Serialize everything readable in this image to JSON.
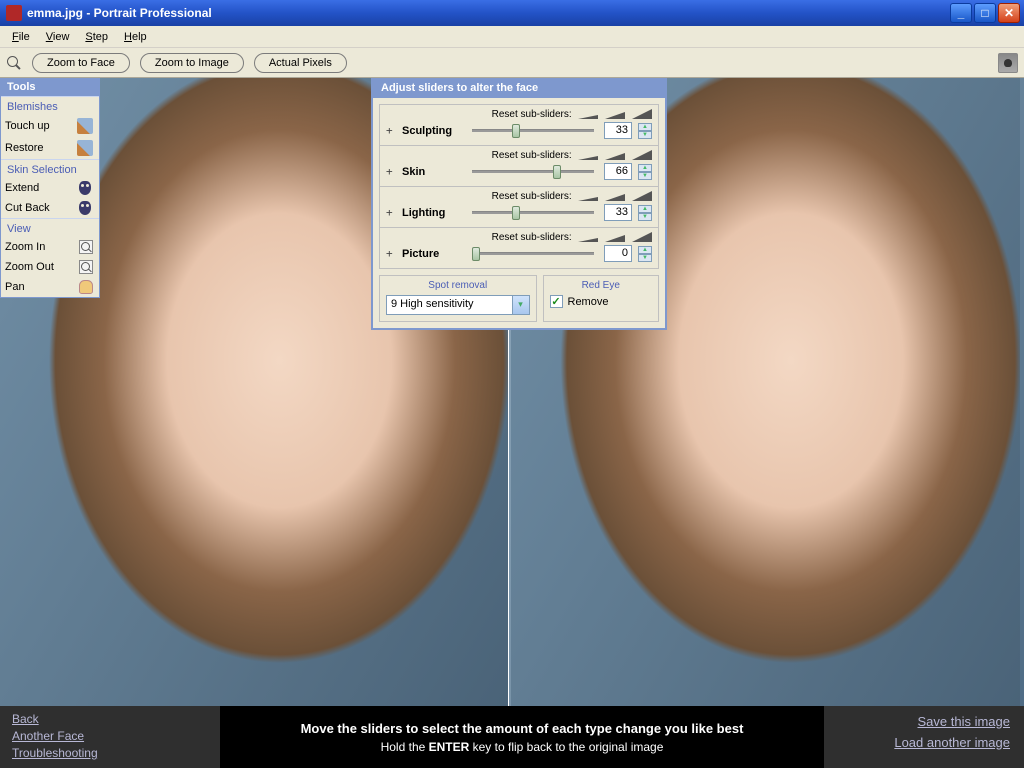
{
  "titlebar": {
    "title": "emma.jpg - Portrait Professional"
  },
  "menubar": {
    "items": [
      "File",
      "View",
      "Step",
      "Help"
    ]
  },
  "toolbar": {
    "zoom_face": "Zoom to Face",
    "zoom_image": "Zoom to Image",
    "actual_pixels": "Actual Pixels"
  },
  "tools": {
    "header": "Tools",
    "blemishes_title": "Blemishes",
    "touch_up": "Touch up",
    "restore": "Restore",
    "skin_title": "Skin Selection",
    "extend": "Extend",
    "cutback": "Cut Back",
    "view_title": "View",
    "zoom_in": "Zoom In",
    "zoom_out": "Zoom Out",
    "pan": "Pan"
  },
  "adjust": {
    "header": "Adjust sliders to alter the face",
    "reset_label": "Reset sub-sliders:",
    "sliders": [
      {
        "label": "Sculpting",
        "value": "33",
        "pos": 33
      },
      {
        "label": "Skin",
        "value": "66",
        "pos": 66
      },
      {
        "label": "Lighting",
        "value": "33",
        "pos": 33
      },
      {
        "label": "Picture",
        "value": "0",
        "pos": 0
      }
    ],
    "spot_title": "Spot removal",
    "spot_value": "9 High sensitivity",
    "redeye_title": "Red Eye",
    "redeye_label": "Remove",
    "redeye_checked": true
  },
  "footer": {
    "back": "Back",
    "another_face": "Another Face",
    "troubleshooting": "Troubleshooting",
    "line1": "Move the sliders to select the amount of each type change you like best",
    "line2_a": "Hold the ",
    "line2_b": "ENTER",
    "line2_c": " key to flip back to the original image",
    "save": "Save this image",
    "load": "Load another image"
  }
}
